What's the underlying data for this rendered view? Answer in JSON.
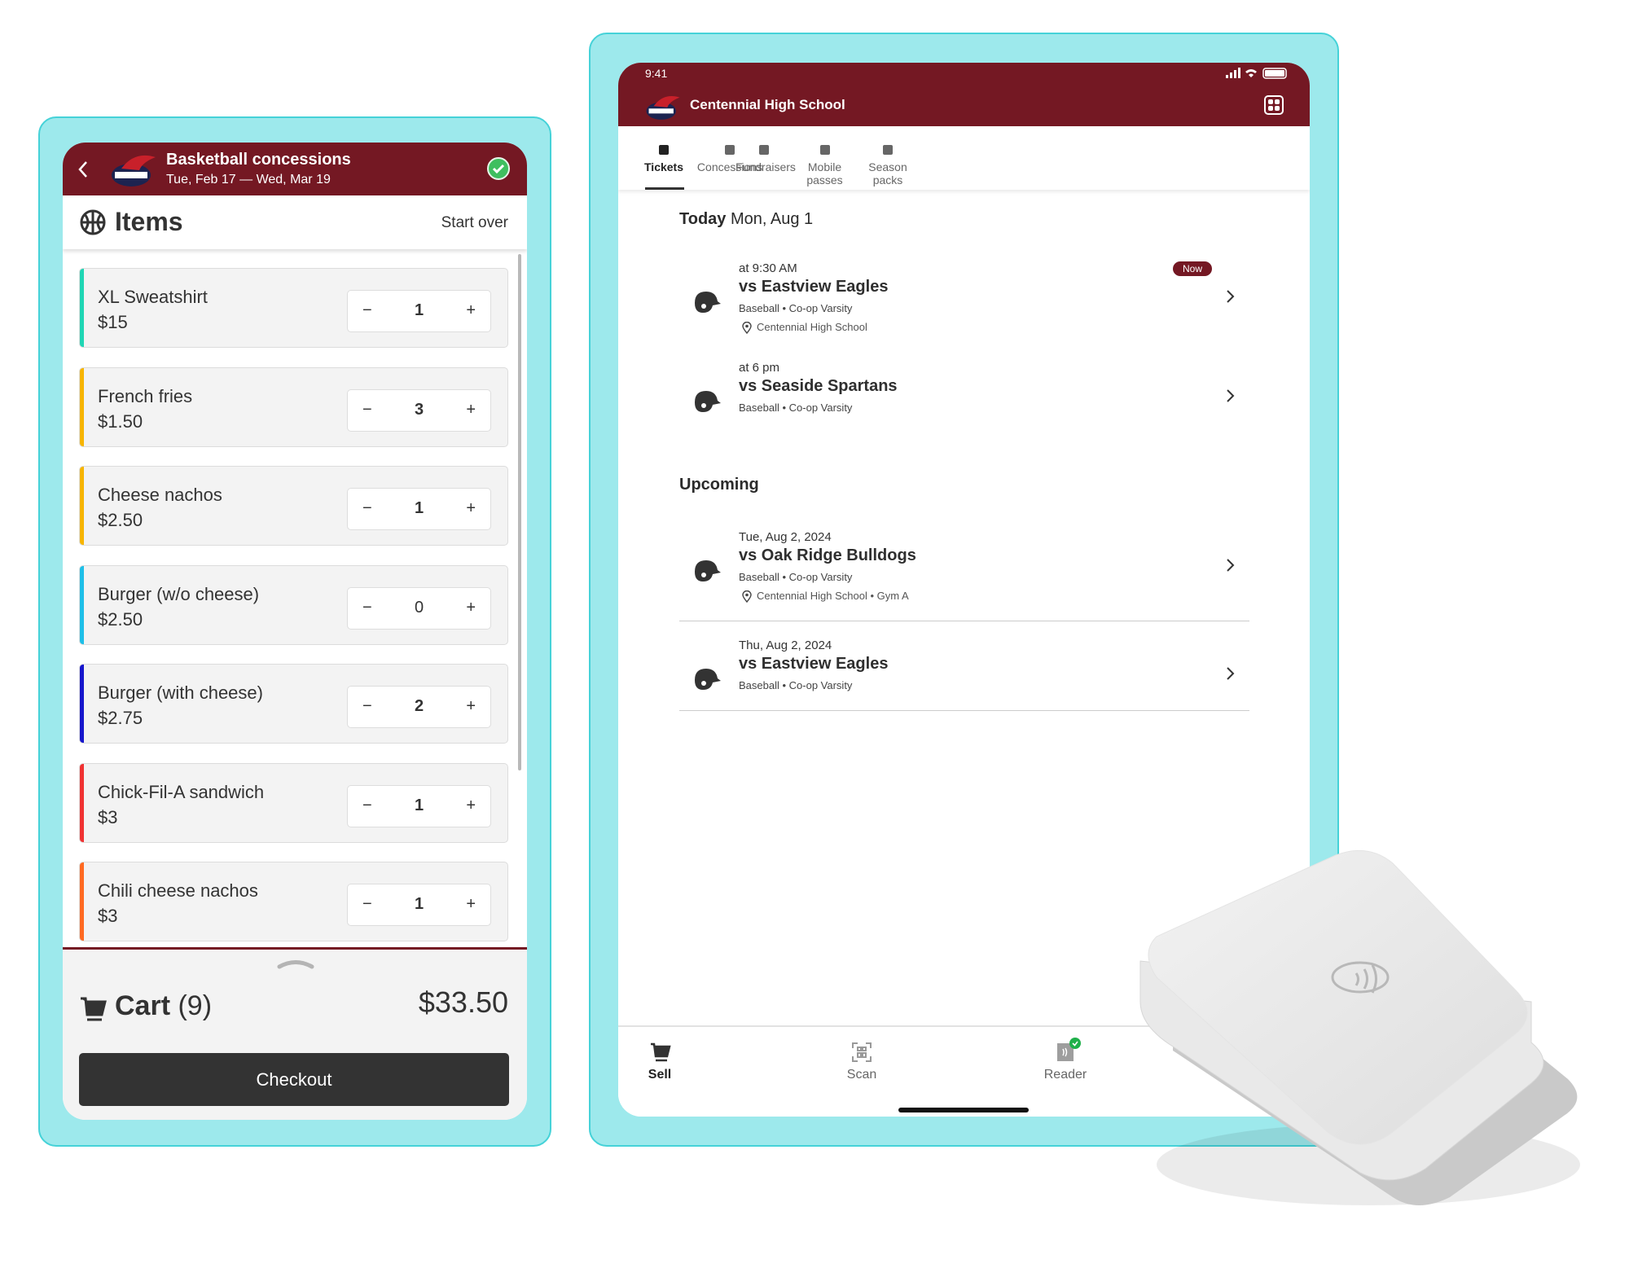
{
  "colors": {
    "brand": "#741823",
    "frame": "#9de9ec",
    "checkout": "#333333",
    "success": "#22b04b"
  },
  "concessions": {
    "header": {
      "title": "Basketball concessions",
      "subtitle": "Tue, Feb 17 — Wed, Mar 19",
      "status_icon": "check-circle-icon"
    },
    "section": {
      "title": "Items",
      "icon": "basketball-icon",
      "start_over": "Start over"
    },
    "items": [
      {
        "name": "XL Sweatshirt",
        "price": "$15",
        "qty": "1",
        "color": "#1fd6b4"
      },
      {
        "name": "French fries",
        "price": "$1.50",
        "qty": "3",
        "color": "#f7b500"
      },
      {
        "name": "Cheese nachos",
        "price": "$2.50",
        "qty": "1",
        "color": "#f7b500"
      },
      {
        "name": "Burger (w/o cheese)",
        "price": "$2.50",
        "qty": "0",
        "color": "#1ebfe8"
      },
      {
        "name": "Burger (with cheese)",
        "price": "$2.75",
        "qty": "2",
        "color": "#1616cc"
      },
      {
        "name": "Chick-Fil-A sandwich",
        "price": "$3",
        "qty": "1",
        "color": "#f03232"
      },
      {
        "name": "Chili cheese nachos",
        "price": "$3",
        "qty": "1",
        "color": "#ff6a22"
      }
    ],
    "cart": {
      "label": "Cart",
      "count": "(9)",
      "total": "$33.50",
      "checkout": "Checkout"
    }
  },
  "tablet": {
    "status": {
      "time": "9:41"
    },
    "header": {
      "title": "Centennial High School"
    },
    "tabs": [
      {
        "label": "Tickets",
        "active": true
      },
      {
        "label": "Concessions"
      },
      {
        "label": "Fundraisers"
      },
      {
        "label": "Mobile passes"
      },
      {
        "label": "Season packs"
      }
    ],
    "today": {
      "label": "Today",
      "date": "Mon, Aug 1"
    },
    "upcoming_label": "Upcoming",
    "events": [
      {
        "time": "at 9:30 AM",
        "title": "vs Eastview Eagles",
        "sub": "Baseball • Co-op Varsity",
        "location": "Centennial High School",
        "badge": "Now"
      },
      {
        "time": "at 6 pm",
        "title": "vs Seaside Spartans",
        "sub": "Baseball • Co-op Varsity"
      },
      {
        "time": "Tue, Aug 2, 2024",
        "title": "vs Oak Ridge Bulldogs",
        "sub": "Baseball • Co-op Varsity",
        "location": "Centennial High School • Gym A"
      },
      {
        "time": "Thu, Aug 2, 2024",
        "title": "vs Eastview Eagles",
        "sub": "Baseball • Co-op Varsity"
      }
    ],
    "nav": [
      {
        "label": "Sell",
        "active": true
      },
      {
        "label": "Scan"
      },
      {
        "label": "Reader"
      }
    ]
  }
}
